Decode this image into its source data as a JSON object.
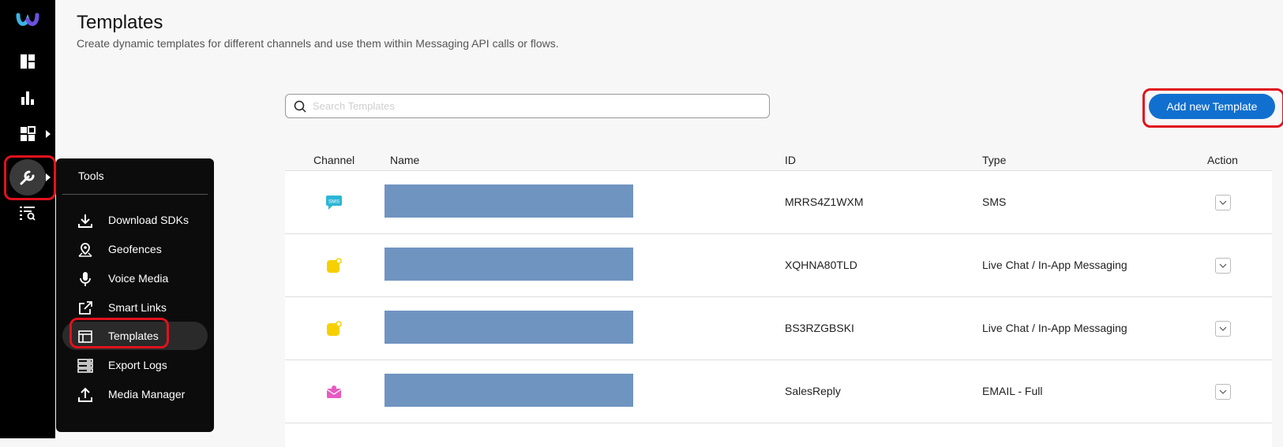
{
  "page": {
    "title": "Templates",
    "subtitle": "Create dynamic templates for different channels and use them within Messaging API calls or flows."
  },
  "search": {
    "placeholder": "Search Templates",
    "value": ""
  },
  "add_button": {
    "label": "Add new Template"
  },
  "table": {
    "headers": {
      "channel": "Channel",
      "name": "Name",
      "id": "ID",
      "type": "Type",
      "action": "Action"
    },
    "rows": [
      {
        "channel_icon": "sms-icon",
        "id": "MRRS4Z1WXM",
        "type": "SMS"
      },
      {
        "channel_icon": "chat-icon",
        "id": "XQHNA80TLD",
        "type": "Live Chat / In-App Messaging"
      },
      {
        "channel_icon": "chat-icon",
        "id": "BS3RZGBSKI",
        "type": "Live Chat / In-App Messaging"
      },
      {
        "channel_icon": "email-icon",
        "id": "SalesReply",
        "type": "EMAIL - Full"
      }
    ]
  },
  "flyout": {
    "title": "Tools",
    "items": [
      {
        "label": "Download SDKs",
        "icon": "download-icon"
      },
      {
        "label": "Geofences",
        "icon": "map-pin-icon"
      },
      {
        "label": "Voice Media",
        "icon": "microphone-icon"
      },
      {
        "label": "Smart Links",
        "icon": "external-link-icon"
      },
      {
        "label": "Templates",
        "icon": "template-icon",
        "active": true
      },
      {
        "label": "Export Logs",
        "icon": "server-icon"
      },
      {
        "label": "Media Manager",
        "icon": "upload-icon"
      }
    ]
  },
  "colors": {
    "accent": "#1170cf",
    "highlight": "#e0121d",
    "sms": "#2bb6d6",
    "chat": "#f6d000",
    "email": "#e85ac2"
  }
}
